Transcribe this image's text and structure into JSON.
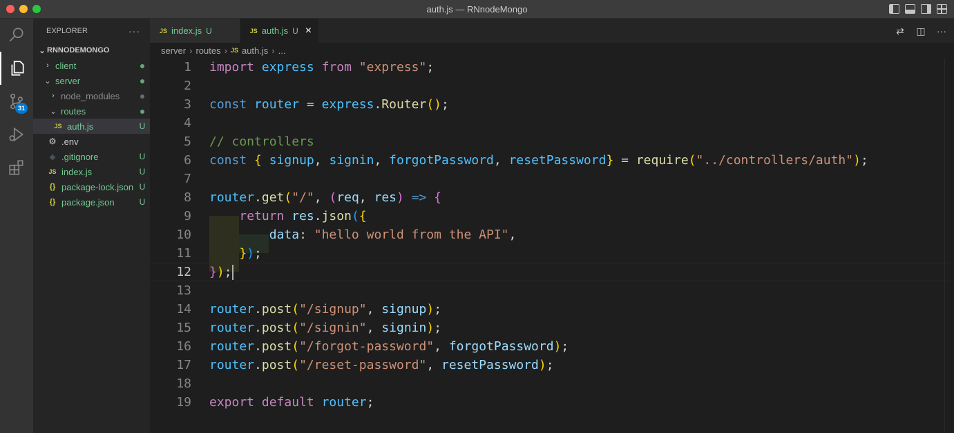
{
  "window": {
    "title": "auth.js — RNnodeMongo"
  },
  "activity": {
    "scm_badge": "31"
  },
  "sidebar": {
    "header": "EXPLORER",
    "more": "···",
    "root": "RNNODEMONGO",
    "items": [
      {
        "label": "client",
        "status": ""
      },
      {
        "label": "server",
        "status": ""
      },
      {
        "label": "node_modules",
        "status": ""
      },
      {
        "label": "routes",
        "status": ""
      },
      {
        "label": "auth.js",
        "status": "U"
      },
      {
        "label": ".env",
        "status": ""
      },
      {
        "label": ".gitignore",
        "status": "U"
      },
      {
        "label": "index.js",
        "status": "U"
      },
      {
        "label": "package-lock.json",
        "status": "U"
      },
      {
        "label": "package.json",
        "status": "U"
      }
    ]
  },
  "tabs": [
    {
      "icon": "JS",
      "label": "index.js",
      "status": "U"
    },
    {
      "icon": "JS",
      "label": "auth.js",
      "status": "U",
      "close": "×"
    }
  ],
  "breadcrumb": {
    "parts": [
      "server",
      "routes",
      "auth.js",
      "..."
    ]
  },
  "code": {
    "line_numbers": [
      "1",
      "2",
      "3",
      "4",
      "5",
      "6",
      "7",
      "8",
      "9",
      "10",
      "11",
      "12",
      "13",
      "14",
      "15",
      "16",
      "17",
      "18",
      "19"
    ],
    "tokens": {
      "import": "import",
      "from": "from",
      "const": "const",
      "return": "return",
      "export": "export",
      "default": "default",
      "express": "express",
      "router": "router",
      "Router": "Router",
      "express_str": "\"express\"",
      "comment": "// controllers",
      "signup": "signup",
      "signin": "signin",
      "forgotPassword": "forgotPassword",
      "resetPassword": "resetPassword",
      "require": "require",
      "controllers_str": "\"../controllers/auth\"",
      "get": "get",
      "post": "post",
      "root_str": "\"/\"",
      "req": "req",
      "res": "res",
      "arrow": "=>",
      "json": "json",
      "data": "data",
      "hello_str": "\"hello world from the API\"",
      "signup_str": "\"/signup\"",
      "signin_str": "\"/signin\"",
      "forgot_str": "\"/forgot-password\"",
      "reset_str": "\"/reset-password\""
    }
  }
}
